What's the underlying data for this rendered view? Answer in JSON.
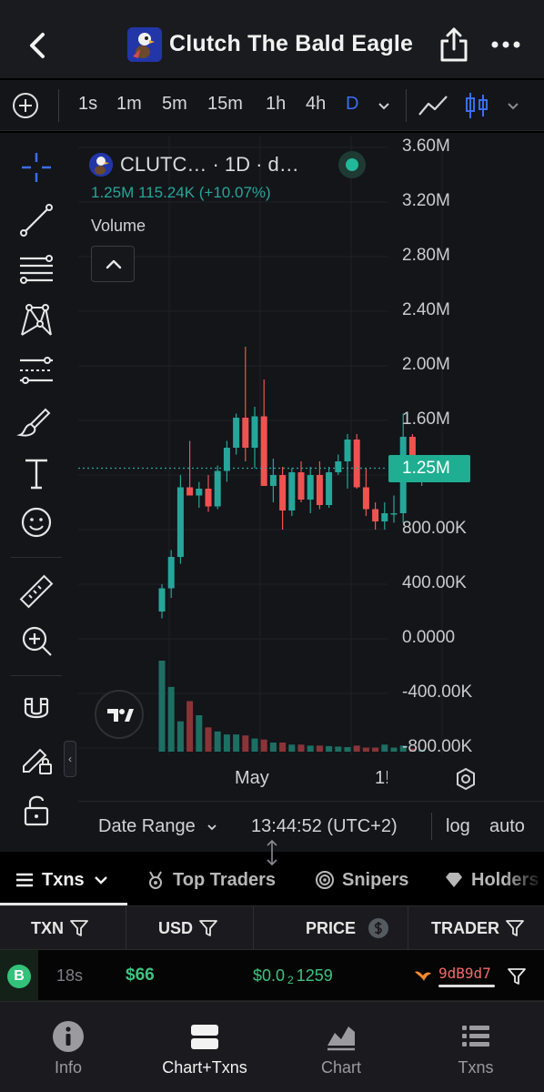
{
  "header": {
    "title": "Clutch The Bald Eagle"
  },
  "timeframes": {
    "items": [
      "1s",
      "1m",
      "5m",
      "15m",
      "1h",
      "4h",
      "D"
    ],
    "active": "D"
  },
  "chart_legend": {
    "symbol": "CLUTC…  · 1D · d…",
    "price_line": "1.25M  115.24K (+10.07%)",
    "volume_label": "Volume"
  },
  "price_axis": {
    "labels": [
      "3.60M",
      "3.20M",
      "2.80M",
      "2.40M",
      "2.00M",
      "1.60M",
      "800.00K",
      "400.00K",
      "0.0000",
      "-400.00K",
      "-800.00K"
    ],
    "current_price_label": "1.25M"
  },
  "time_axis": {
    "labels": [
      "May",
      "1!"
    ]
  },
  "date_bar": {
    "date_range": "Date Range",
    "time": "13:44:52 (UTC+2)",
    "log": "log",
    "auto": "auto"
  },
  "chart_data": {
    "type": "candlestick",
    "title": "CLUTC… · 1D",
    "ylim": [
      -800000,
      3600000
    ],
    "ylabel": "",
    "xlabel": "",
    "current_price": 1250000,
    "up_color": "#26a69a",
    "down_color": "#ef5350",
    "candles": [
      {
        "o": 200000,
        "h": 400000,
        "l": 150000,
        "c": 370000
      },
      {
        "o": 370000,
        "h": 650000,
        "l": 300000,
        "c": 600000
      },
      {
        "o": 600000,
        "h": 1200000,
        "l": 550000,
        "c": 1110000
      },
      {
        "o": 1110000,
        "h": 1450000,
        "l": 1050000,
        "c": 1050000
      },
      {
        "o": 1050000,
        "h": 1150000,
        "l": 960000,
        "c": 1100000
      },
      {
        "o": 1100000,
        "h": 1200000,
        "l": 930000,
        "c": 970000
      },
      {
        "o": 970000,
        "h": 1270000,
        "l": 950000,
        "c": 1230000
      },
      {
        "o": 1230000,
        "h": 1450000,
        "l": 1150000,
        "c": 1400000
      },
      {
        "o": 1400000,
        "h": 1650000,
        "l": 1350000,
        "c": 1620000
      },
      {
        "o": 1620000,
        "h": 2140000,
        "l": 1300000,
        "c": 1400000
      },
      {
        "o": 1400000,
        "h": 1700000,
        "l": 1250000,
        "c": 1630000
      },
      {
        "o": 1630000,
        "h": 1900000,
        "l": 1300000,
        "c": 1120000
      },
      {
        "o": 1120000,
        "h": 1320000,
        "l": 1000000,
        "c": 1200000
      },
      {
        "o": 1200000,
        "h": 1260000,
        "l": 800000,
        "c": 940000
      },
      {
        "o": 940000,
        "h": 1250000,
        "l": 900000,
        "c": 1220000
      },
      {
        "o": 1220000,
        "h": 1300000,
        "l": 1000000,
        "c": 1020000
      },
      {
        "o": 1020000,
        "h": 1260000,
        "l": 920000,
        "c": 1200000
      },
      {
        "o": 1200000,
        "h": 1300000,
        "l": 950000,
        "c": 980000
      },
      {
        "o": 980000,
        "h": 1260000,
        "l": 960000,
        "c": 1220000
      },
      {
        "o": 1220000,
        "h": 1350000,
        "l": 1200000,
        "c": 1300000
      },
      {
        "o": 1300000,
        "h": 1500000,
        "l": 1100000,
        "c": 1460000
      },
      {
        "o": 1460000,
        "h": 1500000,
        "l": 1100000,
        "c": 1110000
      },
      {
        "o": 1110000,
        "h": 1250000,
        "l": 900000,
        "c": 950000
      },
      {
        "o": 950000,
        "h": 1000000,
        "l": 800000,
        "c": 860000
      },
      {
        "o": 860000,
        "h": 1000000,
        "l": 800000,
        "c": 920000
      },
      {
        "o": 920000,
        "h": 1050000,
        "l": 850000,
        "c": 920000
      },
      {
        "o": 920000,
        "h": 1650000,
        "l": 850000,
        "c": 1480000
      },
      {
        "o": 1480000,
        "h": 1500000,
        "l": 1250000,
        "c": 1260000
      },
      {
        "o": 1260000,
        "h": 1320000,
        "l": 1120000,
        "c": 1300000
      }
    ],
    "volume": [
      900,
      640,
      300,
      500,
      360,
      240,
      200,
      170,
      170,
      160,
      130,
      120,
      90,
      90,
      70,
      70,
      60,
      60,
      55,
      50,
      45,
      60,
      40,
      40,
      70,
      40,
      60,
      30,
      20
    ]
  },
  "tabs": {
    "items": [
      {
        "label": "Txns",
        "icon": "list-icon"
      },
      {
        "label": "Top Traders",
        "icon": "medal-icon"
      },
      {
        "label": "Snipers",
        "icon": "target-icon"
      },
      {
        "label": "Holders",
        "icon": "diamond-icon"
      }
    ],
    "active": "Txns"
  },
  "table": {
    "headers": [
      "TXN",
      "USD",
      "PRICE",
      "TRADER"
    ],
    "rows": [
      {
        "side": "B",
        "age": "18s",
        "usd": "$66",
        "price_prefix": "$0.0",
        "price_sub": "2",
        "price_suffix": "1259",
        "trader": "9dB9d7"
      }
    ]
  },
  "bottom_nav": {
    "items": [
      {
        "label": "Info",
        "icon": "info-icon"
      },
      {
        "label": "Chart+Txns",
        "icon": "chart-txns-icon"
      },
      {
        "label": "Chart",
        "icon": "chart-icon"
      },
      {
        "label": "Txns",
        "icon": "txns-icon"
      }
    ],
    "active": "Chart+Txns"
  }
}
